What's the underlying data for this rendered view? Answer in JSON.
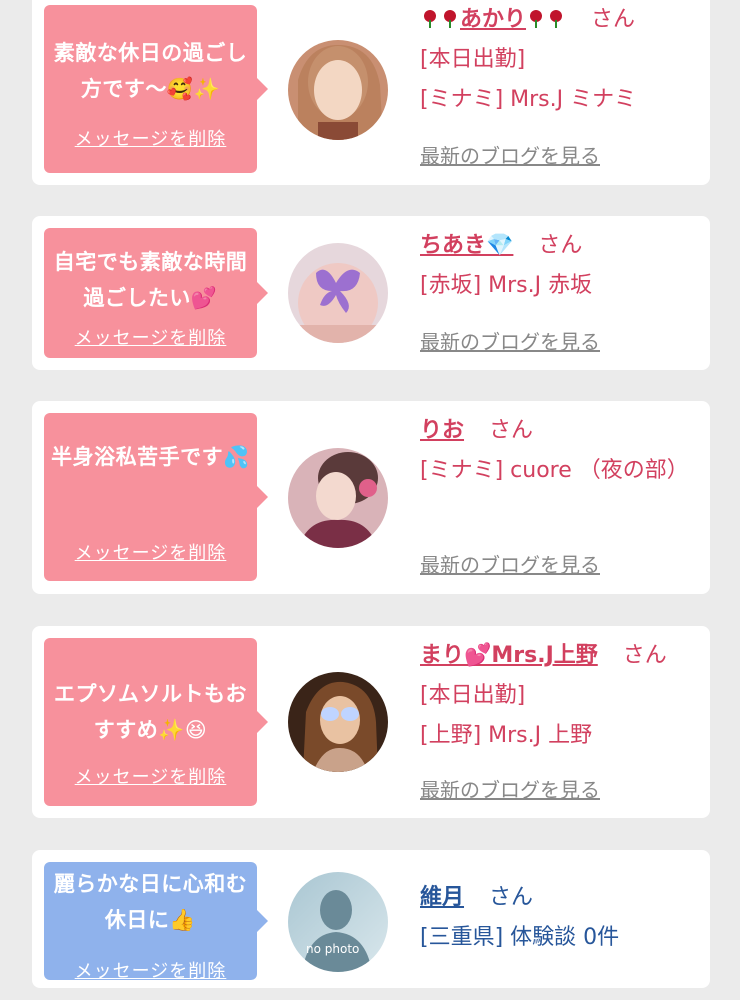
{
  "cards": [
    {
      "message": "素敵な休日の過ごし方です～🥰✨",
      "delete_label": "メッセージを削除",
      "name": "あかり",
      "honorific": "さん",
      "status": "[本日出勤]",
      "shop": "[ミナミ] Mrs.J ミナミ",
      "blog_link": "最新のブログを見る"
    },
    {
      "message": "自宅でも素敵な時間過ごしたい💕",
      "delete_label": "メッセージを削除",
      "name": "ちあき💎",
      "honorific": "さん",
      "shop": "[赤坂] Mrs.J 赤坂",
      "blog_link": "最新のブログを見る"
    },
    {
      "message": "半身浴私苦手です💦",
      "delete_label": "メッセージを削除",
      "name": "りお",
      "honorific": "さん",
      "shop": "[ミナミ] cuore （夜の部）",
      "blog_link": "最新のブログを見る"
    },
    {
      "message": "エプソムソルトもおすすめ✨😆",
      "delete_label": "メッセージを削除",
      "name": "まり💕Mrs.J上野",
      "honorific": "さん",
      "status": "[本日出勤]",
      "shop": "[上野] Mrs.J 上野",
      "blog_link": "最新のブログを見る"
    },
    {
      "message": "麗らかな日に心和む休日に👍",
      "delete_label": "メッセージを削除",
      "name": "維月",
      "honorific": "さん",
      "detail": "[三重県] 体験談 0件",
      "avatar_text": "no photo"
    }
  ],
  "colors": {
    "pink_bubble": "#f7919c",
    "blue_bubble": "#8fb2ec",
    "name_pink": "#d2405f",
    "name_blue": "#27569a",
    "background": "#ebebeb"
  },
  "icons": [
    "rose-icon",
    "avatar-photo",
    "no-photo-avatar"
  ]
}
